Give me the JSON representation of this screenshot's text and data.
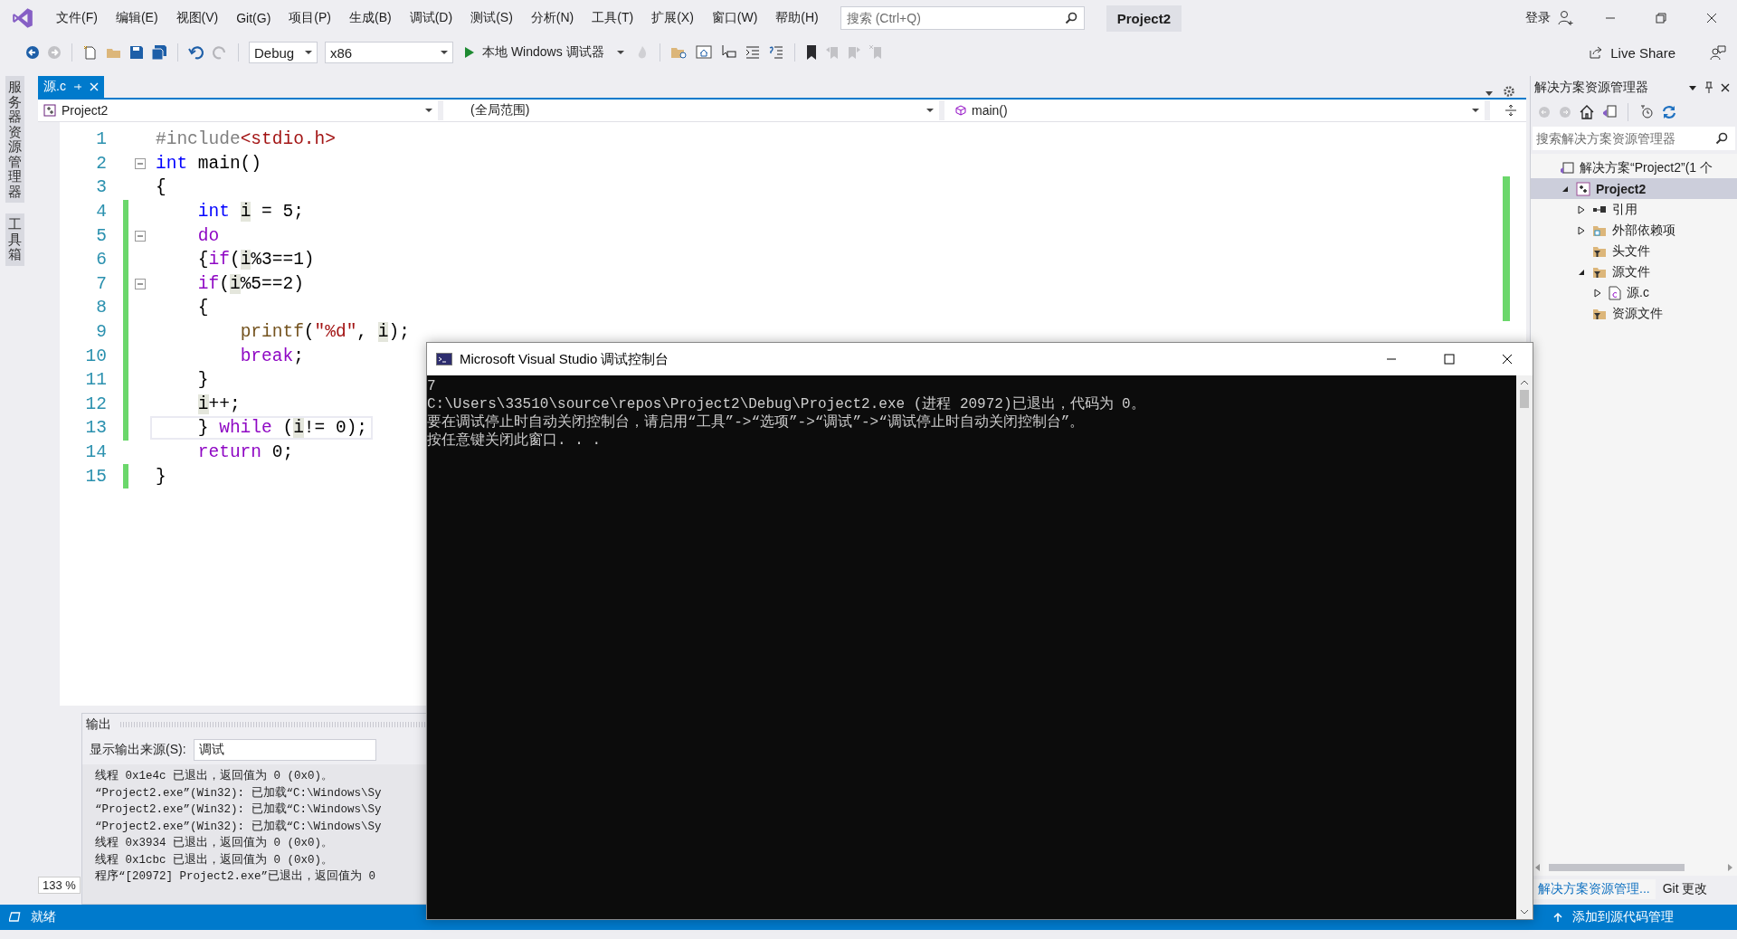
{
  "menu": {
    "items": [
      "文件(F)",
      "编辑(E)",
      "视图(V)",
      "Git(G)",
      "项目(P)",
      "生成(B)",
      "调试(D)",
      "测试(S)",
      "分析(N)",
      "工具(T)",
      "扩展(X)",
      "窗口(W)",
      "帮助(H)"
    ],
    "search": {
      "placeholder": "搜索 (Ctrl+Q)"
    },
    "title": "Project2",
    "login": "登录"
  },
  "toolbar": {
    "configuration": "Debug",
    "platform": "x86",
    "start": "本地 Windows 调试器",
    "live_share": "Live Share"
  },
  "side_tabs": [
    "服务器资源管理器",
    "工具箱"
  ],
  "editor": {
    "tab": {
      "label": "源.c",
      "selected": true
    },
    "nav": [
      "Project2",
      "(全局范围)",
      "main()"
    ],
    "lines": [
      {
        "number": "1",
        "changed": false,
        "fold": false,
        "tokens": [
          {
            "t": "#include",
            "kind": "macro"
          },
          {
            "t": "<stdio.h>",
            "kind": "string"
          }
        ]
      },
      {
        "number": "2",
        "changed": false,
        "fold": true,
        "tokens": [
          {
            "t": "int",
            "kind": "keyword"
          },
          {
            "t": " main()",
            "kind": "plain"
          }
        ]
      },
      {
        "number": "3",
        "changed": false,
        "fold": false,
        "tokens": [
          {
            "t": "{",
            "kind": "plain"
          }
        ]
      },
      {
        "number": "4",
        "changed": true,
        "fold": false,
        "tokens": [
          {
            "t": "    int ",
            "kind": "keyword"
          },
          {
            "t": "i",
            "kind": "ref"
          },
          {
            "t": " = 5;",
            "kind": "plain"
          }
        ]
      },
      {
        "number": "5",
        "changed": true,
        "fold": true,
        "tokens": [
          {
            "t": "    do",
            "kind": "control"
          }
        ]
      },
      {
        "number": "6",
        "changed": true,
        "fold": false,
        "tokens": [
          {
            "t": "    {",
            "kind": "plain"
          },
          {
            "t": "if",
            "kind": "control"
          },
          {
            "t": "(",
            "kind": "plain"
          },
          {
            "t": "i",
            "kind": "ref"
          },
          {
            "t": "%3==1)",
            "kind": "plain"
          }
        ]
      },
      {
        "number": "7",
        "changed": true,
        "fold": true,
        "tokens": [
          {
            "t": "    if",
            "kind": "control"
          },
          {
            "t": "(",
            "kind": "plain"
          },
          {
            "t": "i",
            "kind": "ref"
          },
          {
            "t": "%5==2)",
            "kind": "plain"
          }
        ]
      },
      {
        "number": "8",
        "changed": true,
        "fold": false,
        "tokens": [
          {
            "t": "    {",
            "kind": "plain"
          }
        ]
      },
      {
        "number": "9",
        "changed": true,
        "fold": false,
        "tokens": [
          {
            "t": "        printf",
            "kind": "function"
          },
          {
            "t": "(",
            "kind": "plain"
          },
          {
            "t": "\"%d\"",
            "kind": "string"
          },
          {
            "t": ", ",
            "kind": "plain"
          },
          {
            "t": "i",
            "kind": "ref"
          },
          {
            "t": ");",
            "kind": "plain"
          }
        ]
      },
      {
        "number": "10",
        "changed": true,
        "fold": false,
        "tokens": [
          {
            "t": "        break",
            "kind": "control"
          },
          {
            "t": ";",
            "kind": "plain"
          }
        ]
      },
      {
        "number": "11",
        "changed": true,
        "fold": false,
        "tokens": [
          {
            "t": "    }",
            "kind": "plain"
          }
        ]
      },
      {
        "number": "12",
        "changed": true,
        "fold": false,
        "tokens": [
          {
            "t": "    i",
            "kind": "ref"
          },
          {
            "t": "++;",
            "kind": "plain"
          }
        ]
      },
      {
        "number": "13",
        "changed": true,
        "fold": false,
        "current": true,
        "tokens": [
          {
            "t": "    } ",
            "kind": "plain"
          },
          {
            "t": "while",
            "kind": "control"
          },
          {
            "t": " (",
            "kind": "plain"
          },
          {
            "t": "i",
            "kind": "ref"
          },
          {
            "t": "!= 0);",
            "kind": "plain"
          }
        ]
      },
      {
        "number": "14",
        "changed": false,
        "fold": false,
        "tokens": [
          {
            "t": "    return",
            "kind": "control"
          },
          {
            "t": " 0;",
            "kind": "plain"
          }
        ]
      },
      {
        "number": "15",
        "changed": true,
        "fold": false,
        "tokens": [
          {
            "t": "}",
            "kind": "plain"
          }
        ]
      }
    ],
    "zoom": "133 %"
  },
  "output": {
    "title": "输出",
    "source_label": "显示输出来源(S):",
    "source": "调试",
    "lines": [
      "线程 0x1e4c 已退出，返回值为 0 (0x0)。",
      "“Project2.exe”(Win32): 已加载“C:\\Windows\\Sy",
      "“Project2.exe”(Win32): 已加载“C:\\Windows\\Sy",
      "“Project2.exe”(Win32): 已加载“C:\\Windows\\Sy",
      "线程 0x3934 已退出，返回值为 0 (0x0)。",
      "线程 0x1cbc 已退出，返回值为 0 (0x0)。",
      "程序“[20972] Project2.exe”已退出，返回值为 0"
    ]
  },
  "solution_explorer": {
    "title": "解决方案资源管理器",
    "search": {
      "placeholder": "搜索解决方案资源管理器"
    },
    "tree": [
      {
        "label": "解决方案“Project2”(1 个",
        "kind": "solution",
        "selected": false,
        "children": [
          {
            "label": "Project2",
            "kind": "project",
            "expanded": true,
            "selected": true,
            "children": [
              {
                "label": "引用",
                "kind": "references",
                "expanded": false,
                "selected": false
              },
              {
                "label": "外部依赖项",
                "kind": "external",
                "expanded": false,
                "selected": false
              },
              {
                "label": "头文件",
                "kind": "filter",
                "selected": false
              },
              {
                "label": "源文件",
                "kind": "filter",
                "expanded": true,
                "selected": false,
                "children": [
                  {
                    "label": "源.c",
                    "kind": "file",
                    "expanded": false,
                    "selected": false
                  }
                ]
              },
              {
                "label": "资源文件",
                "kind": "filter",
                "selected": false
              }
            ]
          }
        ]
      }
    ],
    "bottom_tabs": [
      {
        "label": "解决方案资源管理...",
        "selected": true
      },
      {
        "label": "Git 更改",
        "selected": false
      }
    ]
  },
  "status_bar": {
    "text": "就绪",
    "action": "添加到源代码管理"
  },
  "console": {
    "title": "Microsoft Visual Studio 调试控制台",
    "lines": [
      "7",
      "C:\\Users\\33510\\source\\repos\\Project2\\Debug\\Project2.exe (进程 20972)已退出，代码为 0。",
      "要在调试停止时自动关闭控制台，请启用“工具”->“选项”->“调试”->“调试停止时自动关闭控制台”。",
      "按任意键关闭此窗口. . ."
    ]
  }
}
